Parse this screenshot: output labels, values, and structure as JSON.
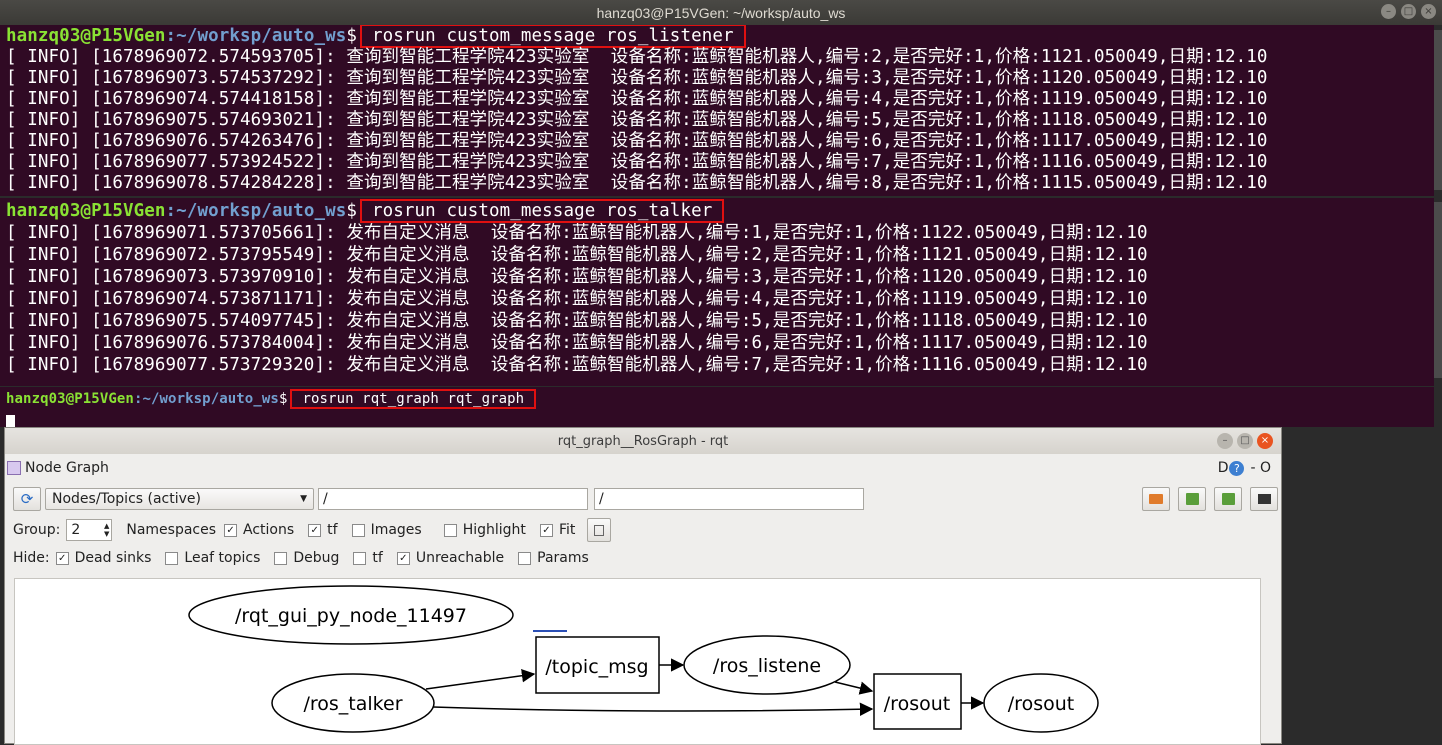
{
  "window": {
    "title": "hanzq03@P15VGen: ~/worksp/auto_ws"
  },
  "terminal1": {
    "prompt_user": "hanzq03@P15VGen",
    "prompt_path": ":~/worksp/auto_ws",
    "prompt_symbol": "$",
    "command": "rosrun custom_message ros_listener",
    "lines": [
      "[ INFO] [1678969072.574593705]: 查询到智能工程学院423实验室  设备名称:蓝鲸智能机器人,编号:2,是否完好:1,价格:1121.050049,日期:12.10",
      "[ INFO] [1678969073.574537292]: 查询到智能工程学院423实验室  设备名称:蓝鲸智能机器人,编号:3,是否完好:1,价格:1120.050049,日期:12.10",
      "[ INFO] [1678969074.574418158]: 查询到智能工程学院423实验室  设备名称:蓝鲸智能机器人,编号:4,是否完好:1,价格:1119.050049,日期:12.10",
      "[ INFO] [1678969075.574693021]: 查询到智能工程学院423实验室  设备名称:蓝鲸智能机器人,编号:5,是否完好:1,价格:1118.050049,日期:12.10",
      "[ INFO] [1678969076.574263476]: 查询到智能工程学院423实验室  设备名称:蓝鲸智能机器人,编号:6,是否完好:1,价格:1117.050049,日期:12.10",
      "[ INFO] [1678969077.573924522]: 查询到智能工程学院423实验室  设备名称:蓝鲸智能机器人,编号:7,是否完好:1,价格:1116.050049,日期:12.10",
      "[ INFO] [1678969078.574284228]: 查询到智能工程学院423实验室  设备名称:蓝鲸智能机器人,编号:8,是否完好:1,价格:1115.050049,日期:12.10"
    ]
  },
  "terminal2": {
    "prompt_user": "hanzq03@P15VGen",
    "prompt_path": ":~/worksp/auto_ws",
    "prompt_symbol": "$",
    "command": "rosrun custom_message ros_talker",
    "lines": [
      "[ INFO] [1678969071.573705661]: 发布自定义消息  设备名称:蓝鲸智能机器人,编号:1,是否完好:1,价格:1122.050049,日期:12.10",
      "[ INFO] [1678969072.573795549]: 发布自定义消息  设备名称:蓝鲸智能机器人,编号:2,是否完好:1,价格:1121.050049,日期:12.10",
      "[ INFO] [1678969073.573970910]: 发布自定义消息  设备名称:蓝鲸智能机器人,编号:3,是否完好:1,价格:1120.050049,日期:12.10",
      "[ INFO] [1678969074.573871171]: 发布自定义消息  设备名称:蓝鲸智能机器人,编号:4,是否完好:1,价格:1119.050049,日期:12.10",
      "[ INFO] [1678969075.574097745]: 发布自定义消息  设备名称:蓝鲸智能机器人,编号:5,是否完好:1,价格:1118.050049,日期:12.10",
      "[ INFO] [1678969076.573784004]: 发布自定义消息  设备名称:蓝鲸智能机器人,编号:6,是否完好:1,价格:1117.050049,日期:12.10",
      "[ INFO] [1678969077.573729320]: 发布自定义消息  设备名称:蓝鲸智能机器人,编号:7,是否完好:1,价格:1116.050049,日期:12.10"
    ]
  },
  "terminal3": {
    "prompt_user": "hanzq03@P15VGen",
    "prompt_path": ":~/worksp/auto_ws",
    "prompt_symbol": "$",
    "command": "rosrun rqt_graph rqt_graph"
  },
  "rqt": {
    "title": "rqt_graph__RosGraph - rqt",
    "plugin_label": "Node Graph",
    "plugin_controls": "D",
    "plugin_extra": "- O",
    "mode": "Nodes/Topics (active)",
    "filter1": "/",
    "filter2": "/",
    "group_label": "Group:",
    "group_value": "2",
    "namespaces": "Namespaces",
    "actions": "Actions",
    "tf": "tf",
    "images": "Images",
    "highlight": "Highlight",
    "fit": "Fit",
    "hide_label": "Hide:",
    "dead_sinks": "Dead sinks",
    "leaf_topics": "Leaf topics",
    "debug": "Debug",
    "tf2": "tf",
    "unreachable": "Unreachable",
    "params": "Params"
  },
  "graph": {
    "nodes": {
      "gui": "/rqt_gui_py_node_11497",
      "talker": "/ros_talker",
      "topic_msg": "/topic_msg",
      "listener": "/ros_listene",
      "rosout_node": "/rosout",
      "rosout_topic": "/rosout"
    }
  },
  "colors": {
    "terminal_bg": "#300a24",
    "prompt_user": "#8ae234",
    "prompt_path": "#729fcf",
    "highlight_box": "#e01010"
  }
}
